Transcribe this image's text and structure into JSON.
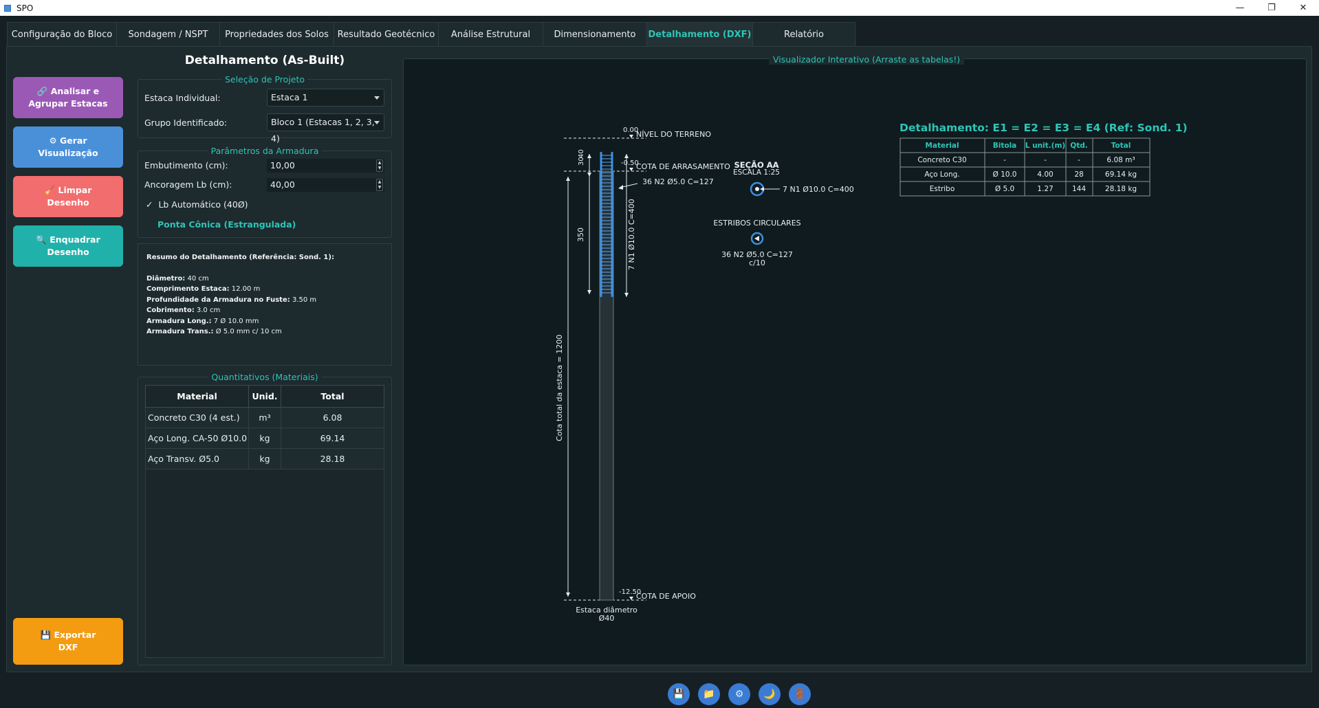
{
  "window": {
    "title": "SPO"
  },
  "tabs": [
    {
      "label": "Configuração do Bloco"
    },
    {
      "label": "Sondagem / NSPT"
    },
    {
      "label": "Propriedades dos Solos"
    },
    {
      "label": "Resultado Geotécnico"
    },
    {
      "label": "Análise Estrutural"
    },
    {
      "label": "Dimensionamento"
    },
    {
      "label": "Detalhamento (DXF)"
    },
    {
      "label": "Relatório"
    }
  ],
  "actions": {
    "analisar": {
      "line1": "🔗 Analisar e",
      "line2": "Agrupar Estacas",
      "color": "#9b59b6"
    },
    "gerar": {
      "line1": "⚙ Gerar",
      "line2": "Visualização",
      "color": "#4a90d9"
    },
    "limpar": {
      "line1": "🧹 Limpar",
      "line2": "Desenho",
      "color": "#f26d6d"
    },
    "enquadrar": {
      "line1": "🔍 Enquadrar",
      "line2": "Desenho",
      "color": "#20b2aa"
    },
    "exportar": {
      "line1": "💾 Exportar",
      "line2": "DXF",
      "color": "#f39c12"
    }
  },
  "panel": {
    "title": "Detalhamento (As-Built)",
    "selecao": {
      "legend": "Seleção de Projeto",
      "estaca_label": "Estaca Individual:",
      "estaca_value": "Estaca 1",
      "grupo_label": "Grupo Identificado:",
      "grupo_value": "Bloco 1 (Estacas 1, 2, 3, 4)"
    },
    "armadura": {
      "legend": "Parâmetros da Armadura",
      "embutimento_label": "Embutimento (cm):",
      "embutimento_value": "10,00",
      "ancoragem_label": "Ancoragem Lb (cm):",
      "ancoragem_value": "40,00",
      "lb_auto_check": "✓",
      "lb_auto_label": "Lb Automático (40Ø)",
      "ponta_label": "Ponta Cônica (Estrangulada)"
    },
    "resumo": {
      "title": "Resumo do Detalhamento (Referência: Sond. 1):",
      "items": [
        {
          "k": "Diâmetro:",
          "v": "40 cm"
        },
        {
          "k": "Comprimento Estaca:",
          "v": "12.00 m"
        },
        {
          "k": "Profundidade da Armadura no Fuste:",
          "v": "3.50 m"
        },
        {
          "k": "Cobrimento:",
          "v": "3.0 cm"
        },
        {
          "k": "Armadura Long.:",
          "v": "7 Ø 10.0 mm"
        },
        {
          "k": "Armadura Trans.:",
          "v": "Ø 5.0 mm c/ 10 cm"
        }
      ]
    },
    "quantitativos": {
      "legend": "Quantitativos (Materiais)",
      "headers": [
        "Material",
        "Unid.",
        "Total"
      ],
      "rows": [
        [
          "Concreto C30 (4 est.)",
          "m³",
          "6.08"
        ],
        [
          "Aço Long. CA-50 Ø10.0",
          "kg",
          "69.14"
        ],
        [
          "Aço Transv. Ø5.0",
          "kg",
          "28.18"
        ]
      ]
    }
  },
  "viewer": {
    "title": "Visualizador Interativo (Arraste as tabelas!)",
    "drawing": {
      "nivel_terreno_val": "0.00",
      "nivel_terreno": "NÍVEL DO TERRENO",
      "cota_arras_val": "-0.50",
      "cota_arras": "COTA DE ARRASAMENTO",
      "cota_apoio_val": "-12.50",
      "cota_apoio": "COTA DE APOIO",
      "dim_30": "30",
      "dim_40": "40",
      "dim_350": "350",
      "dim_total": "Cota total da estaca = 1200",
      "long_bar": "7 N1 Ø10.0 C=400",
      "n2_label": "36 N2 Ø5.0 C=127",
      "estaca_diam_1": "Estaca diâmetro",
      "estaca_diam_2": "Ø40",
      "secao": "SEÇÃO AA",
      "escala": "ESCALA 1:25",
      "secao_bar": "7 N1 Ø10.0 C=400",
      "estribos": "ESTRIBOS CIRCULARES",
      "estribos_n2": "36 N2 Ø5.0 C=127",
      "estribos_c": "c/10"
    },
    "table_title": "Detalhamento: E1 = E2 = E3 = E4 (Ref: Sond. 1)",
    "table_headers": [
      "Material",
      "Bitola",
      "L unit.(m)",
      "Qtd.",
      "Total"
    ],
    "table_rows": [
      [
        "Concreto C30",
        "-",
        "-",
        "-",
        "6.08 m³"
      ],
      [
        "Aço Long.",
        "Ø 10.0",
        "4.00",
        "28",
        "69.14 kg"
      ],
      [
        "Estribo",
        "Ø 5.0",
        "1.27",
        "144",
        "28.18 kg"
      ]
    ]
  },
  "bottom": {
    "icons": [
      {
        "name": "save-icon",
        "glyph": "💾"
      },
      {
        "name": "folder-icon",
        "glyph": "📁"
      },
      {
        "name": "gear-icon",
        "glyph": "⚙"
      },
      {
        "name": "moon-icon",
        "glyph": "🌙"
      },
      {
        "name": "exit-icon",
        "glyph": "🚪"
      }
    ]
  }
}
